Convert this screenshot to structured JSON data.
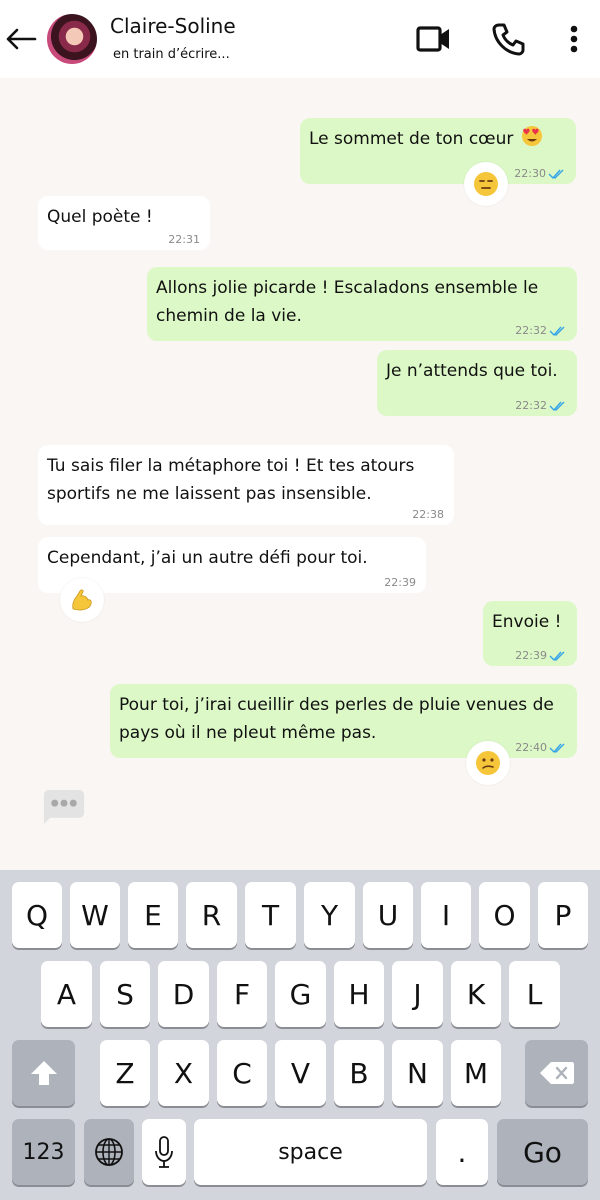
{
  "header": {
    "contact_name": "Claire-Soline",
    "status": "en train d’écrire..."
  },
  "messages": [
    {
      "text": "Le sommet de ton cœur",
      "emoji": "heart-eyes",
      "time": "22:30",
      "direction": "out",
      "read": true,
      "reaction": "expressionless-face"
    },
    {
      "text": "Quel poète !",
      "time": "22:31",
      "direction": "in"
    },
    {
      "text": "Allons jolie picarde ! Escaladons ensemble le chemin de la vie.",
      "time": "22:32",
      "direction": "out",
      "read": true
    },
    {
      "text": "Je n’attends que toi.",
      "time": "22:32",
      "direction": "out",
      "read": true
    },
    {
      "text": "Tu sais filer la métaphore toi ! Et tes atours sportifs ne me laissent pas insensible.",
      "time": "22:38",
      "direction": "in"
    },
    {
      "text": "Cependant, j’ai un autre défi pour toi.",
      "time": "22:39",
      "direction": "in",
      "reaction": "flexed-biceps"
    },
    {
      "text": "Envoie !",
      "time": "22:39",
      "direction": "out",
      "read": true
    },
    {
      "text": "Pour toi, j’irai cueillir des perles de pluie venues de pays où il ne pleut même pas.",
      "time": "22:40",
      "direction": "out",
      "read": true,
      "reaction": "confused-face"
    }
  ],
  "keyboard": {
    "row1": [
      "Q",
      "W",
      "E",
      "R",
      "T",
      "Y",
      "U",
      "I",
      "O",
      "P"
    ],
    "row2": [
      "A",
      "S",
      "D",
      "F",
      "G",
      "H",
      "J",
      "K",
      "L"
    ],
    "row3": [
      "Z",
      "X",
      "C",
      "V",
      "B",
      "N",
      "M"
    ],
    "numbers_label": "123",
    "space_label": "space",
    "period_label": ".",
    "go_label": "Go"
  },
  "colors": {
    "outgoing_bubble": "#dcf8c6",
    "incoming_bubble": "#ffffff",
    "chat_background": "#faf6f3",
    "read_tick": "#34a4e8",
    "keyboard_background": "#d2d5db"
  }
}
